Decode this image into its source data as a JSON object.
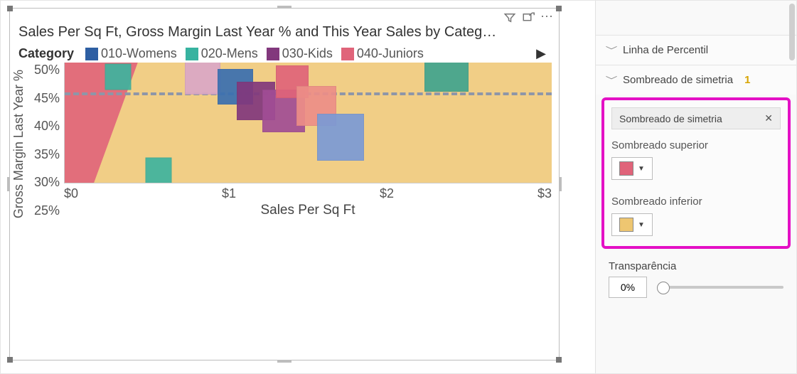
{
  "chart_data": {
    "type": "scatter",
    "title": "Sales Per Sq Ft, Gross Margin Last Year % and This Year Sales by Categ…",
    "xlabel": "Sales Per Sq Ft",
    "ylabel": "Gross Margin Last Year %",
    "xlim": [
      0,
      3
    ],
    "ylim": [
      25,
      50
    ],
    "xticks": [
      "$0",
      "$1",
      "$2",
      "$3"
    ],
    "yticks": [
      "50%",
      "45%",
      "40%",
      "35%",
      "30%",
      "25%"
    ],
    "legend_title": "Category",
    "series": [
      {
        "name": "010-Womens",
        "color": "#2e5fa3"
      },
      {
        "name": "020-Mens",
        "color": "#37b3a0"
      },
      {
        "name": "030-Kids",
        "color": "#82387d"
      },
      {
        "name": "040-Juniors",
        "color": "#e0647a"
      }
    ],
    "reference_line_y": 43.5,
    "symmetry_shading": {
      "upper": "#e0647a",
      "lower": "#eec671"
    },
    "points": [
      {
        "series": "020-Mens",
        "x": 0.33,
        "y": 47,
        "size": 35,
        "color": "#3fb39e"
      },
      {
        "series": "020-Mens",
        "x": 0.58,
        "y": 27.5,
        "size": 35,
        "color": "#3fb39e"
      },
      {
        "series": "030-Kids",
        "x": 0.85,
        "y": 47,
        "size": 48,
        "color": "#dba8c6"
      },
      {
        "series": "010-Womens",
        "x": 1.05,
        "y": 45,
        "size": 48,
        "color": "#3a6fb0"
      },
      {
        "series": "030-Kids",
        "x": 1.18,
        "y": 42,
        "size": 52,
        "color": "#82387d"
      },
      {
        "series": "030-Kids",
        "x": 1.35,
        "y": 40,
        "size": 58,
        "color": "#a14d95"
      },
      {
        "series": "040-Juniors",
        "x": 1.4,
        "y": 46,
        "size": 44,
        "color": "#e0647a"
      },
      {
        "series": "040-Juniors",
        "x": 1.55,
        "y": 41,
        "size": 54,
        "color": "#ed8e88"
      },
      {
        "series": "010-Womens",
        "x": 1.7,
        "y": 34.5,
        "size": 64,
        "color": "#7b9ad6"
      },
      {
        "series": "020-Mens",
        "x": 2.35,
        "y": 48.5,
        "size": 60,
        "color": "#41a48e"
      }
    ]
  },
  "toolbar": {
    "filter": "filter",
    "focus": "focus-mode",
    "more": "⋯"
  },
  "side": {
    "percentile_card": "Linha de Percentil",
    "symmetry_card": "Sombreado de simetria",
    "symmetry_count": "1",
    "chip_label": "Sombreado de simetria",
    "upper_label": "Sombreado superior",
    "lower_label": "Sombreado inferior",
    "upper_color": "#e0647a",
    "lower_color": "#eec671",
    "transparency_label": "Transparência",
    "transparency_value": "0%"
  }
}
